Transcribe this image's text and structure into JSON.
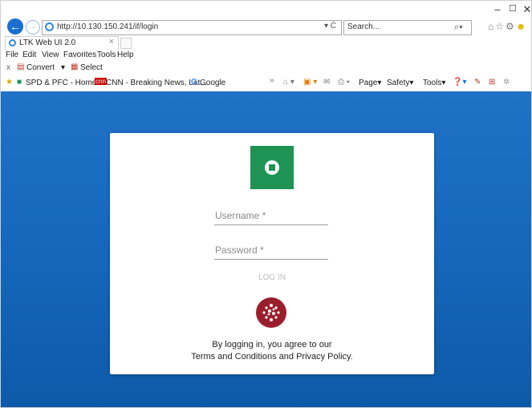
{
  "browser": {
    "url": "http://10.130.150.241/if/login",
    "search_placeholder": "Search...",
    "tab_title": "LTK Web UI 2.0",
    "tab_close": "×",
    "window_controls": {
      "minimize": "–",
      "maximize": "☐",
      "close": "✕"
    },
    "address_tools": "▾ Ċ",
    "menu": [
      "File",
      "Edit",
      "View",
      "Favorites",
      "Tools",
      "Help"
    ],
    "command_bar": {
      "close": "x",
      "convert": "Convert",
      "select": "Select"
    },
    "favorites": [
      "SPD & PFC - Home",
      "CNN - Breaking News, Lat...",
      "Google"
    ],
    "toolbar_right": {
      "page": "Page",
      "safety": "Safety",
      "tools": "Tools"
    }
  },
  "login": {
    "username_placeholder": "Username *",
    "password_placeholder": "Password *",
    "login_label": "LOG IN",
    "agree_line1": "By logging in, you agree to our",
    "agree_line2": "Terms and Conditions and Privacy Policy."
  },
  "colors": {
    "background": "#1667bb",
    "logo_green": "#1e9354",
    "badge_red": "#9a1f2c"
  }
}
